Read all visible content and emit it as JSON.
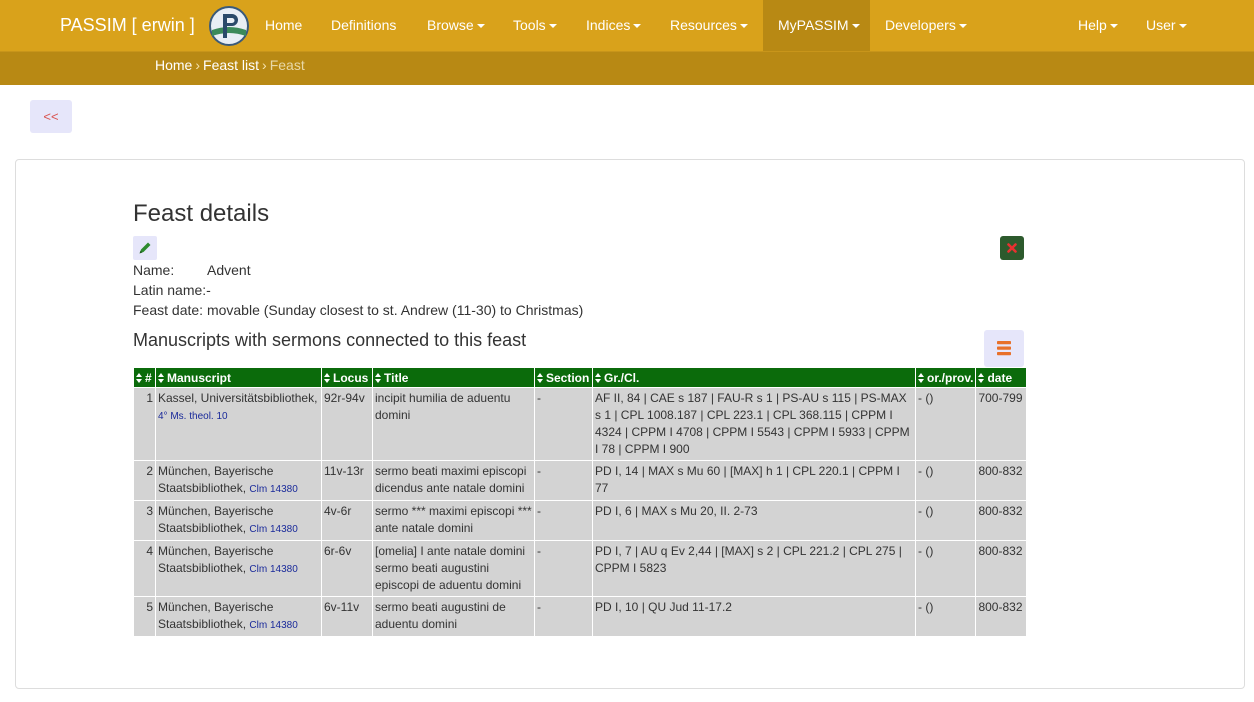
{
  "navbar": {
    "brand": "PASSIM [ erwin ]",
    "items": [
      "Home",
      "Definitions",
      "Browse",
      "Tools",
      "Indices",
      "Resources",
      "MyPASSIM",
      "Developers",
      "Help",
      "User"
    ]
  },
  "breadcrumb": {
    "home": "Home",
    "list": "Feast list",
    "current": "Feast"
  },
  "back_label": "<<",
  "detail": {
    "title": "Feast details",
    "name_label": "Name:",
    "name_value": "Advent",
    "latin_label": "Latin name:",
    "latin_value": "-",
    "date_label": "Feast date:",
    "date_value": "movable (Sunday closest to st. Andrew (11-30) to Christmas)"
  },
  "manuscripts": {
    "title": "Manuscripts with sermons connected to this feast",
    "columns": [
      "#",
      "Manuscript",
      "Locus",
      "Title",
      "Section",
      "Gr./Cl.",
      "or./prov.",
      "date"
    ],
    "rows": [
      {
        "num": "1",
        "ms": "Kassel, Universitätsbibliothek,",
        "shelf": "4° Ms. theol. 10",
        "locus": "92r-94v",
        "title": "incipit humilia de aduentu domini",
        "section": "-",
        "grcl": "AF II, 84 | CAE s 187 | FAU-R s 1 | PS-AU s 115 | PS-MAX s 1 | CPL 1008.187 | CPL 223.1 | CPL 368.115 | CPPM I 4324 | CPPM I 4708 | CPPM I 5543 | CPPM I 5933 | CPPM I 78 | CPPM I 900",
        "orprov": "- ()",
        "date": "700-799"
      },
      {
        "num": "2",
        "ms": "München, Bayerische Staatsbibliothek,",
        "shelf": "Clm 14380",
        "locus": "11v-13r",
        "title": "sermo beati maximi episcopi dicendus ante natale domini",
        "section": "-",
        "grcl": "PD I, 14 | MAX s Mu 60 | [MAX] h 1 | CPL 220.1 | CPPM I 77",
        "orprov": "- ()",
        "date": "800-832"
      },
      {
        "num": "3",
        "ms": "München, Bayerische Staatsbibliothek,",
        "shelf": "Clm 14380",
        "locus": "4v-6r",
        "title": "sermo *** maximi episcopi *** ante natale domini",
        "section": "-",
        "grcl": "PD I, 6 | MAX s Mu 20, II. 2-73",
        "orprov": "- ()",
        "date": "800-832"
      },
      {
        "num": "4",
        "ms": "München, Bayerische Staatsbibliothek,",
        "shelf": "Clm 14380",
        "locus": "6r-6v",
        "title": "[omelia] I ante natale domini sermo beati augustini episcopi de aduentu domini",
        "section": "-",
        "grcl": "PD I, 7 | AU q Ev 2,44 | [MAX] s 2 | CPL 221.2 | CPL 275 | CPPM I 5823",
        "orprov": "- ()",
        "date": "800-832"
      },
      {
        "num": "5",
        "ms": "München, Bayerische Staatsbibliothek,",
        "shelf": "Clm 14380",
        "locus": "6v-11v",
        "title": "sermo beati augustini de aduentu domini",
        "section": "-",
        "grcl": "PD I, 10 | QU Jud 11-17.2",
        "orprov": "- ()",
        "date": "800-832"
      }
    ]
  }
}
